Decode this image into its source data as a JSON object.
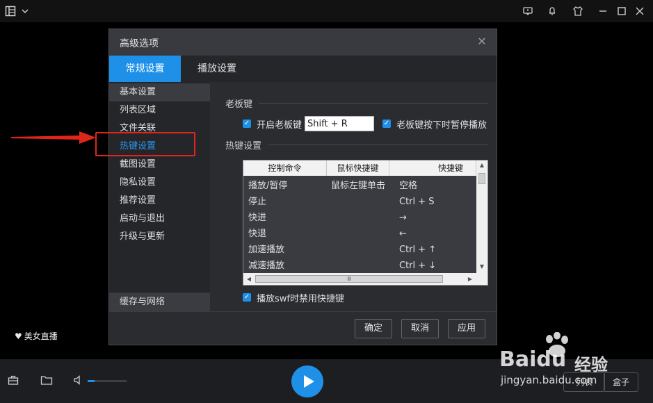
{
  "topbar": {
    "icons": [
      "menu-grid-icon",
      "chevron-down-icon",
      "feedback-icon",
      "notification-icon",
      "skin-icon",
      "minimize-icon",
      "maximize-icon",
      "close-icon"
    ]
  },
  "dialog": {
    "title": "高级选项",
    "tabs": [
      "常规设置",
      "播放设置"
    ],
    "sidebar": [
      "基本设置",
      "列表区域",
      "文件关联",
      "热键设置",
      "截图设置",
      "隐私设置",
      "推荐设置",
      "启动与退出",
      "升级与更新",
      "缓存与网络"
    ],
    "boss_key": {
      "section": "老板键",
      "enable_label": "开启老板键",
      "hotkey": "Shift + R",
      "pause_label": "老板键按下时暂停播放"
    },
    "hotkeys": {
      "section": "热键设置",
      "columns": [
        "控制命令",
        "鼠标快捷键",
        "快捷键"
      ],
      "rows": [
        [
          "播放/暂停",
          "鼠标左键单击",
          "空格"
        ],
        [
          "停止",
          "",
          "Ctrl + S"
        ],
        [
          "快进",
          "",
          "→"
        ],
        [
          "快退",
          "",
          "←"
        ],
        [
          "加速播放",
          "",
          "Ctrl + ↑"
        ],
        [
          "减速播放",
          "",
          "Ctrl + ↓"
        ]
      ],
      "scroll_mark": "Ⅲ"
    },
    "swf_label": "播放swf时禁用快捷键",
    "buttons": {
      "ok": "确定",
      "cancel": "取消",
      "apply": "应用"
    }
  },
  "live_label": "美女直播",
  "bottom": {
    "volume_level": 0.18,
    "pill_left": "列表",
    "pill_right": "盒子"
  },
  "watermark": {
    "brand": "Baidu",
    "product": "经验",
    "url": "jingyan.baidu.com"
  },
  "colors": {
    "accent": "#1e90e8",
    "annotation": "#e0261c"
  }
}
